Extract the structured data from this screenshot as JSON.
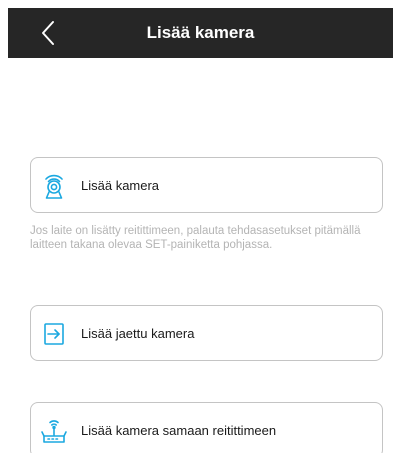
{
  "header": {
    "title": "Lisää kamera",
    "back_icon": "chevron-left-icon"
  },
  "options": [
    {
      "label": "Lisää kamera",
      "icon": "camera-signal-icon"
    },
    {
      "label": "Lisää jaettu kamera",
      "icon": "share-in-icon"
    },
    {
      "label": "Lisää kamera samaan reitittimeen",
      "icon": "router-icon"
    }
  ],
  "hint": "Jos laite on lisätty reitittimeen, palauta tehdasasetukset pitämällä laitteen takana olevaa SET-painiketta pohjassa.",
  "colors": {
    "accent": "#1ba8e0",
    "header_bg": "#262626",
    "hint_text": "#b4b4b4"
  }
}
